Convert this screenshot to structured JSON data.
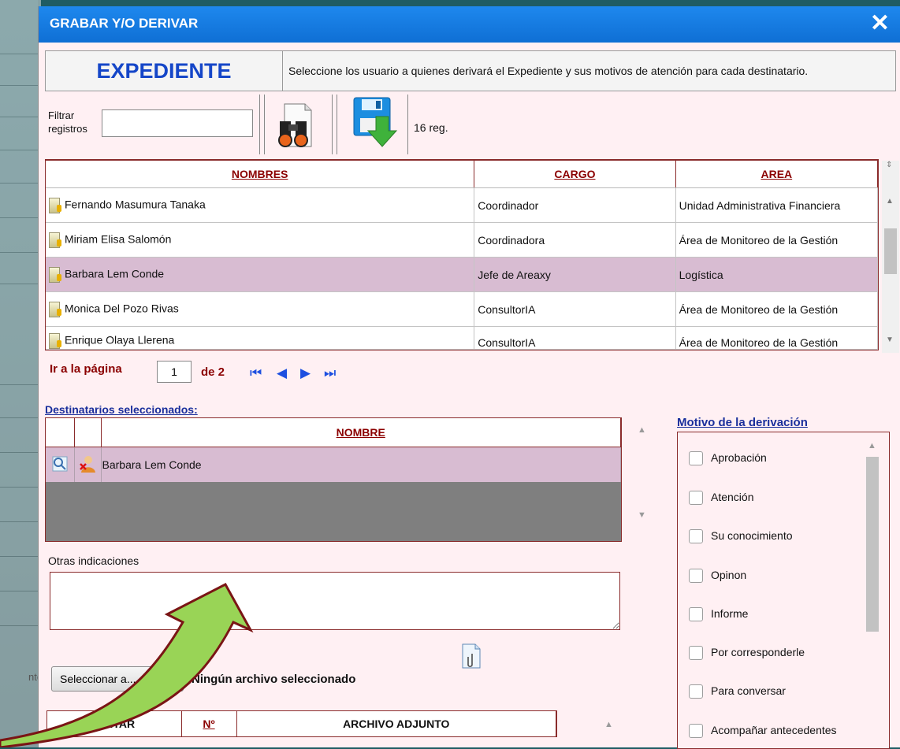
{
  "background": {
    "partial_text": "ntos"
  },
  "dialog": {
    "title": "GRABAR Y/O DERIVAR",
    "close_glyph": "✕",
    "accent": "#1E88EE",
    "header": {
      "left": "EXPEDIENTE",
      "right": "Seleccione los usuario a quienes derivará el Expediente y sus motivos de atención para cada destinatario."
    },
    "filter": {
      "label": "Filtrar registros",
      "value": "",
      "record_count": "16 reg."
    },
    "grid": {
      "columns": [
        "NOMBRES",
        "CARGO",
        "AREA"
      ],
      "rows": [
        {
          "name": "Fernando Masumura Tanaka",
          "cargo": "Coordinador",
          "area": "Unidad Administrativa Financiera",
          "selected": false
        },
        {
          "name": "Miriam Elisa Salomón",
          "cargo": "Coordinadora",
          "area": "Área de Monitoreo de la Gestión",
          "selected": false
        },
        {
          "name": "Barbara Lem Conde",
          "cargo": "Jefe de Areaxy",
          "area": "Logística",
          "selected": true
        },
        {
          "name": "Monica Del Pozo Rivas",
          "cargo": "ConsultorIA",
          "area": "Área de Monitoreo de la Gestión",
          "selected": false
        },
        {
          "name": "Enrique Olaya Llerena",
          "cargo": "ConsultorIA",
          "area": "Área de Monitoreo de la Gestión",
          "selected": false
        }
      ]
    },
    "pager": {
      "label": "Ir a la página",
      "page": "1",
      "of_label": "de 2"
    },
    "destinatarios": {
      "label": "Destinatarios seleccionados:",
      "column": "NOMBRE",
      "rows": [
        {
          "name": "Barbara Lem Conde"
        }
      ]
    },
    "otras": {
      "label": "Otras indicaciones",
      "value": ""
    },
    "file": {
      "button_label": "Seleccionar a...",
      "status": "Ningún archivo seleccionado"
    },
    "attachments": {
      "columns": [
        "QUITAR",
        "Nº",
        "ARCHIVO ADJUNTO"
      ]
    },
    "motivo": {
      "label": "Motivo de la derivación",
      "options": [
        "Aprobación",
        "Atención",
        "Su conocimiento",
        "Opinon",
        "Informe",
        "Por corresponderle",
        "Para conversar",
        "Acompañar antecedentes"
      ]
    }
  }
}
